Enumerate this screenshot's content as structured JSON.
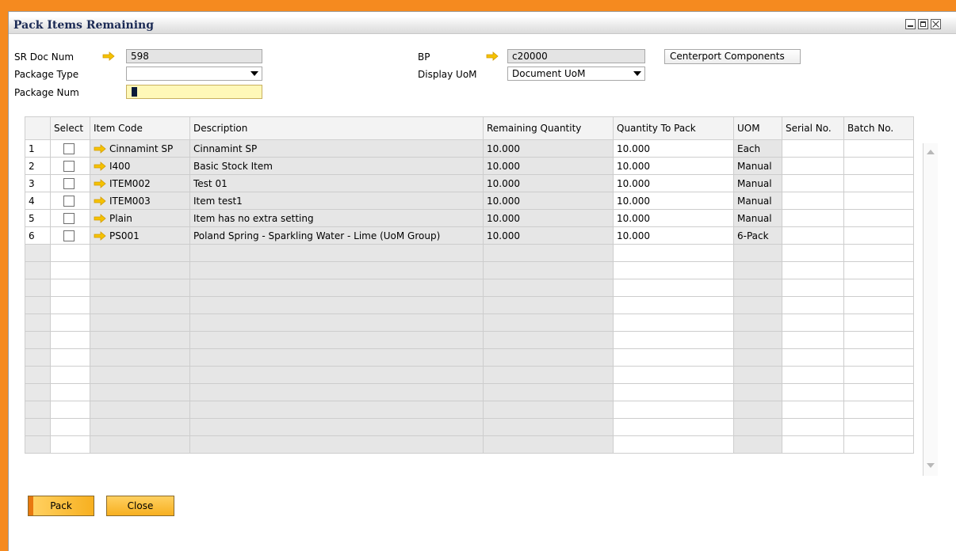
{
  "window": {
    "title": "Pack Items Remaining"
  },
  "header": {
    "sr_doc_num_label": "SR Doc Num",
    "sr_doc_num_value": "598",
    "package_type_label": "Package Type",
    "package_type_value": "",
    "package_num_label": "Package Num",
    "package_num_value": "1",
    "bp_label": "BP",
    "bp_value": "c20000",
    "bp_name": "Centerport Components",
    "display_uom_label": "Display UoM",
    "display_uom_value": "Document UoM"
  },
  "table": {
    "columns": [
      "Select",
      "Item Code",
      "Description",
      "Remaining Quantity",
      "Quantity To Pack",
      "UOM",
      "Serial No.",
      "Batch No."
    ],
    "rows": [
      {
        "num": "1",
        "code": "Cinnamint SP",
        "desc": "Cinnamint SP",
        "remaining": "10.000",
        "to_pack": "10.000",
        "uom": "Each"
      },
      {
        "num": "2",
        "code": "I400",
        "desc": "Basic Stock Item",
        "remaining": "10.000",
        "to_pack": "10.000",
        "uom": "Manual"
      },
      {
        "num": "3",
        "code": "ITEM002",
        "desc": "Test 01",
        "remaining": "10.000",
        "to_pack": "10.000",
        "uom": "Manual"
      },
      {
        "num": "4",
        "code": "ITEM003",
        "desc": "Item test1",
        "remaining": "10.000",
        "to_pack": "10.000",
        "uom": "Manual"
      },
      {
        "num": "5",
        "code": "Plain",
        "desc": "Item has no extra setting",
        "remaining": "10.000",
        "to_pack": "10.000",
        "uom": "Manual"
      },
      {
        "num": "6",
        "code": "PS001",
        "desc": "Poland Spring - Sparkling Water - Lime (UoM Group)",
        "remaining": "10.000",
        "to_pack": "10.000",
        "uom": "6-Pack"
      }
    ]
  },
  "buttons": {
    "pack": "Pack",
    "close": "Close"
  },
  "icons": {
    "link_arrow": "link-arrow-icon",
    "dropdown": "chevron-down-icon"
  },
  "colors": {
    "accent": "#f58a1f",
    "link_arrow": "#f5c200",
    "focused_field": "#fff8b8"
  }
}
